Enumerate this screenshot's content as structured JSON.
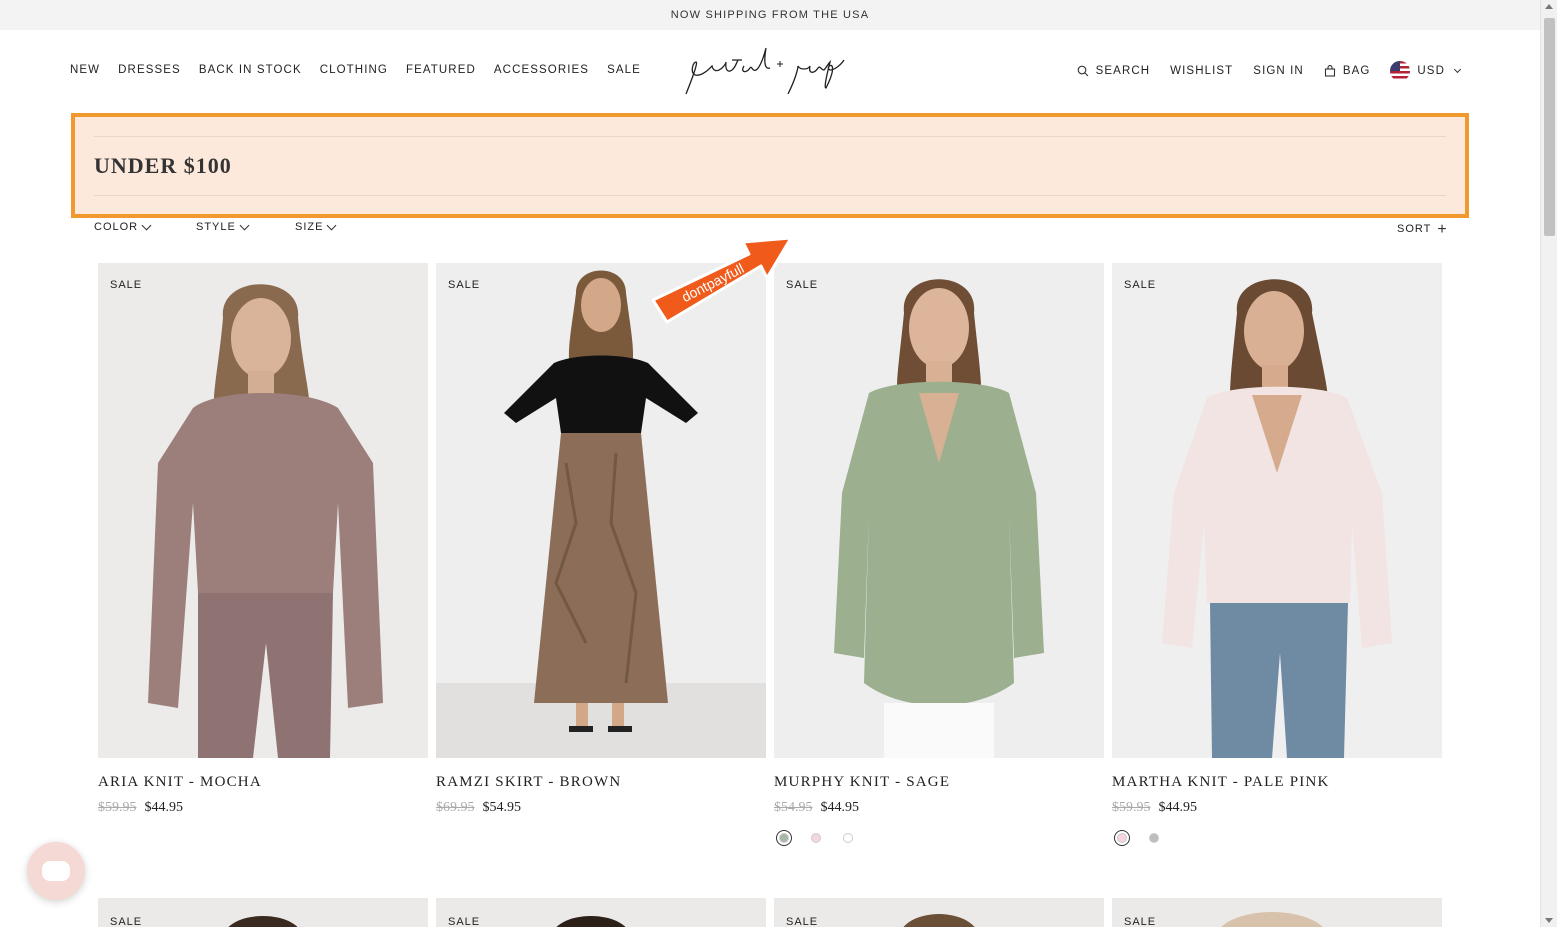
{
  "announcement": "NOW SHIPPING FROM THE USA",
  "nav_left": [
    "NEW",
    "DRESSES",
    "BACK IN STOCK",
    "CLOTHING",
    "FEATURED",
    "ACCESSORIES",
    "SALE"
  ],
  "logo": "petal + pup",
  "nav_right": {
    "search": "SEARCH",
    "wishlist": "WISHLIST",
    "signin": "SIGN IN",
    "bag": "BAG",
    "currency": "USD"
  },
  "page_title": "UNDER $100",
  "filters": [
    "COLOR",
    "STYLE",
    "SIZE"
  ],
  "sort_label": "SORT",
  "arrow_text": "dontpayfull",
  "colors": {
    "highlight_border": "#f0992f",
    "highlight_bg": "#fde9db",
    "arrow": "#f05a1a"
  },
  "products": [
    {
      "badge": "SALE",
      "name": "ARIA KNIT - MOCHA",
      "old_price": "$59.95",
      "price": "$44.95",
      "swatches": []
    },
    {
      "badge": "SALE",
      "name": "RAMZI SKIRT - BROWN",
      "old_price": "$69.95",
      "price": "$54.95",
      "swatches": []
    },
    {
      "badge": "SALE",
      "name": "MURPHY KNIT - SAGE",
      "old_price": "$54.95",
      "price": "$44.95",
      "swatches": [
        "#a7b9a6",
        "#f4d6df",
        "#ffffff"
      ]
    },
    {
      "badge": "SALE",
      "name": "MARTHA KNIT - PALE PINK",
      "old_price": "$59.95",
      "price": "$44.95",
      "swatches": [
        "#f6d3de",
        "#bdbdbd"
      ]
    }
  ],
  "row2_badges": [
    "SALE",
    "SALE",
    "SALE",
    "SALE"
  ]
}
